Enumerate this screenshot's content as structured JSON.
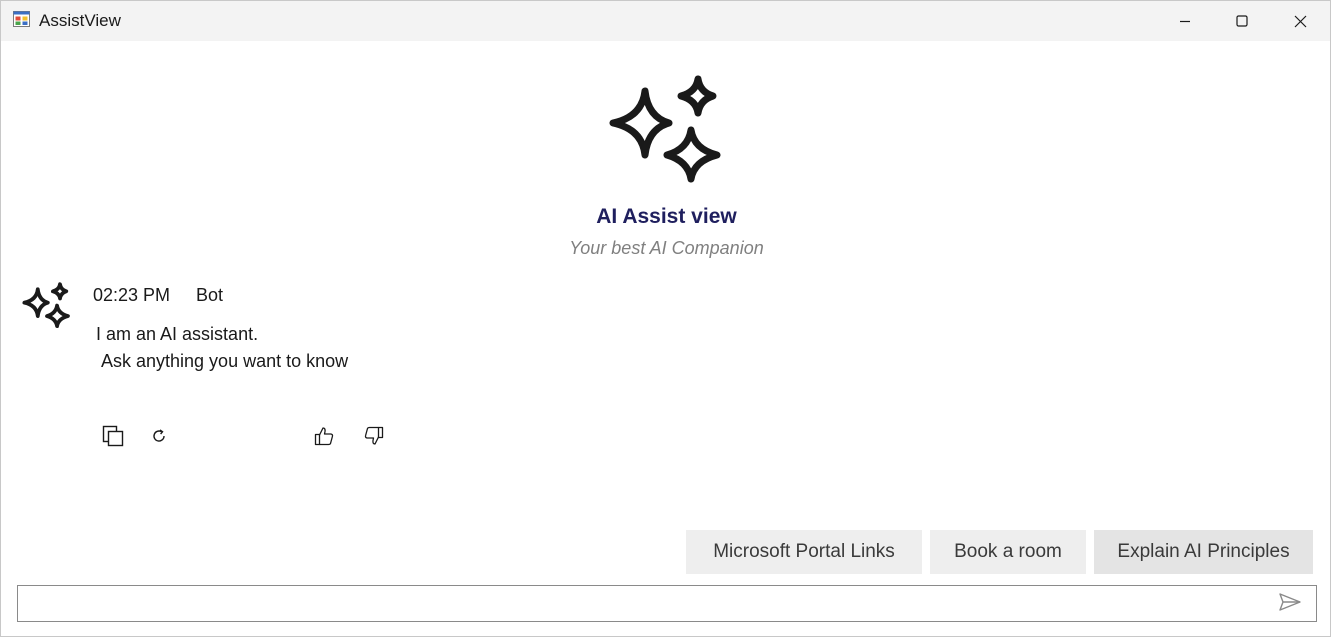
{
  "window": {
    "title": "AssistView",
    "icons": {
      "app": "app-window-icon",
      "minimize": "minimize-icon",
      "maximize": "maximize-icon",
      "close": "close-icon"
    }
  },
  "header": {
    "title": "AI Assist view",
    "subtitle": "Your best AI Companion",
    "icon": "sparkles-icon",
    "title_color": "#1f1f5e",
    "subtitle_color": "#808080"
  },
  "message": {
    "time": "02:23 PM",
    "sender": "Bot",
    "text_line1": "I am an AI assistant.",
    "text_line2": "Ask anything you want to know",
    "avatar_icon": "sparkles-icon",
    "actions": [
      "copy-icon",
      "regenerate-icon",
      "thumbs-up-icon",
      "thumbs-down-icon"
    ]
  },
  "suggestions": [
    {
      "label": "Microsoft Portal Links"
    },
    {
      "label": "Book a room"
    },
    {
      "label": "Explain AI Principles"
    }
  ],
  "input": {
    "value": "",
    "placeholder": "",
    "send_icon": "send-icon"
  },
  "colors": {
    "titlebar_bg": "#f3f3f3",
    "suggestion_bg": "#eeeeee",
    "input_border": "#8a8a8a"
  }
}
